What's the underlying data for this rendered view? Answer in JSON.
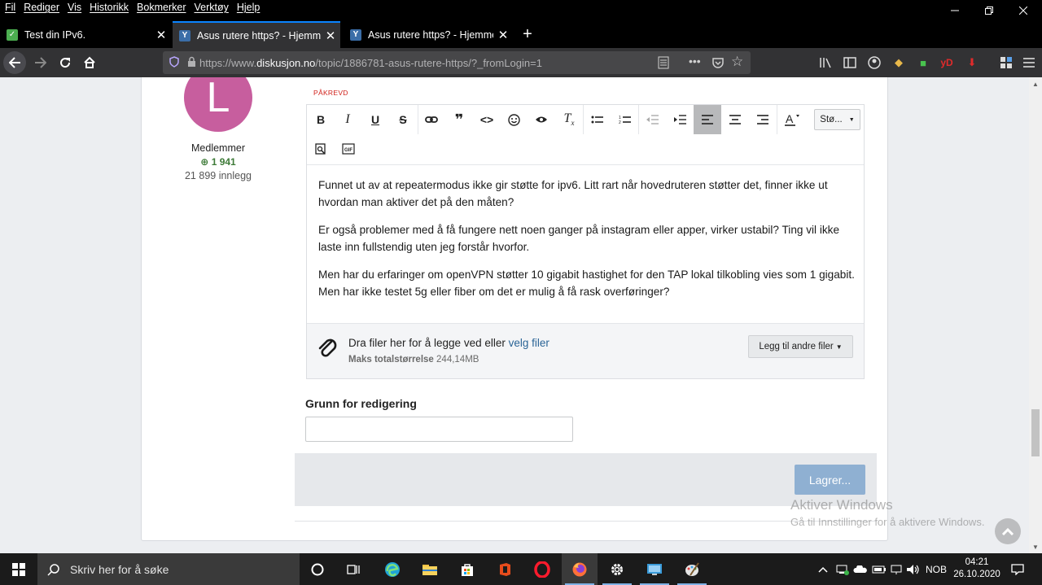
{
  "menubar": {
    "items": [
      "Fil",
      "Rediger",
      "Vis",
      "Historikk",
      "Bokmerker",
      "Verktøy",
      "Hjelp"
    ]
  },
  "tabs": [
    {
      "title": "Test din IPv6.",
      "active": false
    },
    {
      "title": "Asus rutere https? - Hjemmene",
      "active": true
    },
    {
      "title": "Asus rutere https? - Hjemmene",
      "active": false
    }
  ],
  "urlbar": {
    "prefix": "https://www.",
    "domain": "diskusjon.no",
    "path": "/topic/1886781-asus-rutere-https/?_fromLogin=1"
  },
  "toolbar_icons": [
    "library-icon",
    "sidebar-icon",
    "account-icon",
    "extension-icon",
    "extension-icon-2",
    "yd-extension",
    "download-icon",
    "extensions-puzzle-icon",
    "hamburger-menu-icon"
  ],
  "user": {
    "avatar_letter": "L",
    "avatar_color": "#c75e9e",
    "group": "Medlemmer",
    "reputation": "1 941",
    "posts": "21 899 innlegg"
  },
  "editor": {
    "required_label": "PÅKREVD",
    "style_label": "Stø...",
    "paragraphs": [
      "Funnet ut av at repeatermodus ikke gir støtte for ipv6. Litt rart når hovedruteren støtter det, finner ikke ut hvordan man aktiver det på den måten?",
      "Er også problemer med å få fungere nett noen ganger på instagram eller apper, virker ustabil? Ting vil ikke laste inn fullstendig uten jeg forstår hvorfor.",
      "Men har du erfaringer om openVPN støtter 10 gigabit hastighet for den TAP lokal tilkobling vies som 1 gigabit. Men har ikke testet 5g eller fiber om det er mulig å få rask overføringer?"
    ]
  },
  "attachments": {
    "drop_text": "Dra filer her for å legge ved eller ",
    "choose_link": "velg filer",
    "max_label": "Maks totalstørrelse",
    "max_value": "244,14MB",
    "add_button": "Legg til andre filer"
  },
  "edit_reason": {
    "label": "Grunn for redigering",
    "value": ""
  },
  "save_button": "Lagrer...",
  "watermark": {
    "title": "Aktiver Windows",
    "subtitle": "Gå til Innstillinger for å aktivere Windows."
  },
  "taskbar": {
    "search_placeholder": "Skriv her for å søke",
    "language": "NOB",
    "time": "04:21",
    "date": "26.10.2020"
  },
  "colors": {
    "accent": "#0a84ff",
    "link": "#2a6496",
    "required": "#d0201a",
    "reputation": "#3d7a37",
    "save_button": "#8fb0d2"
  }
}
